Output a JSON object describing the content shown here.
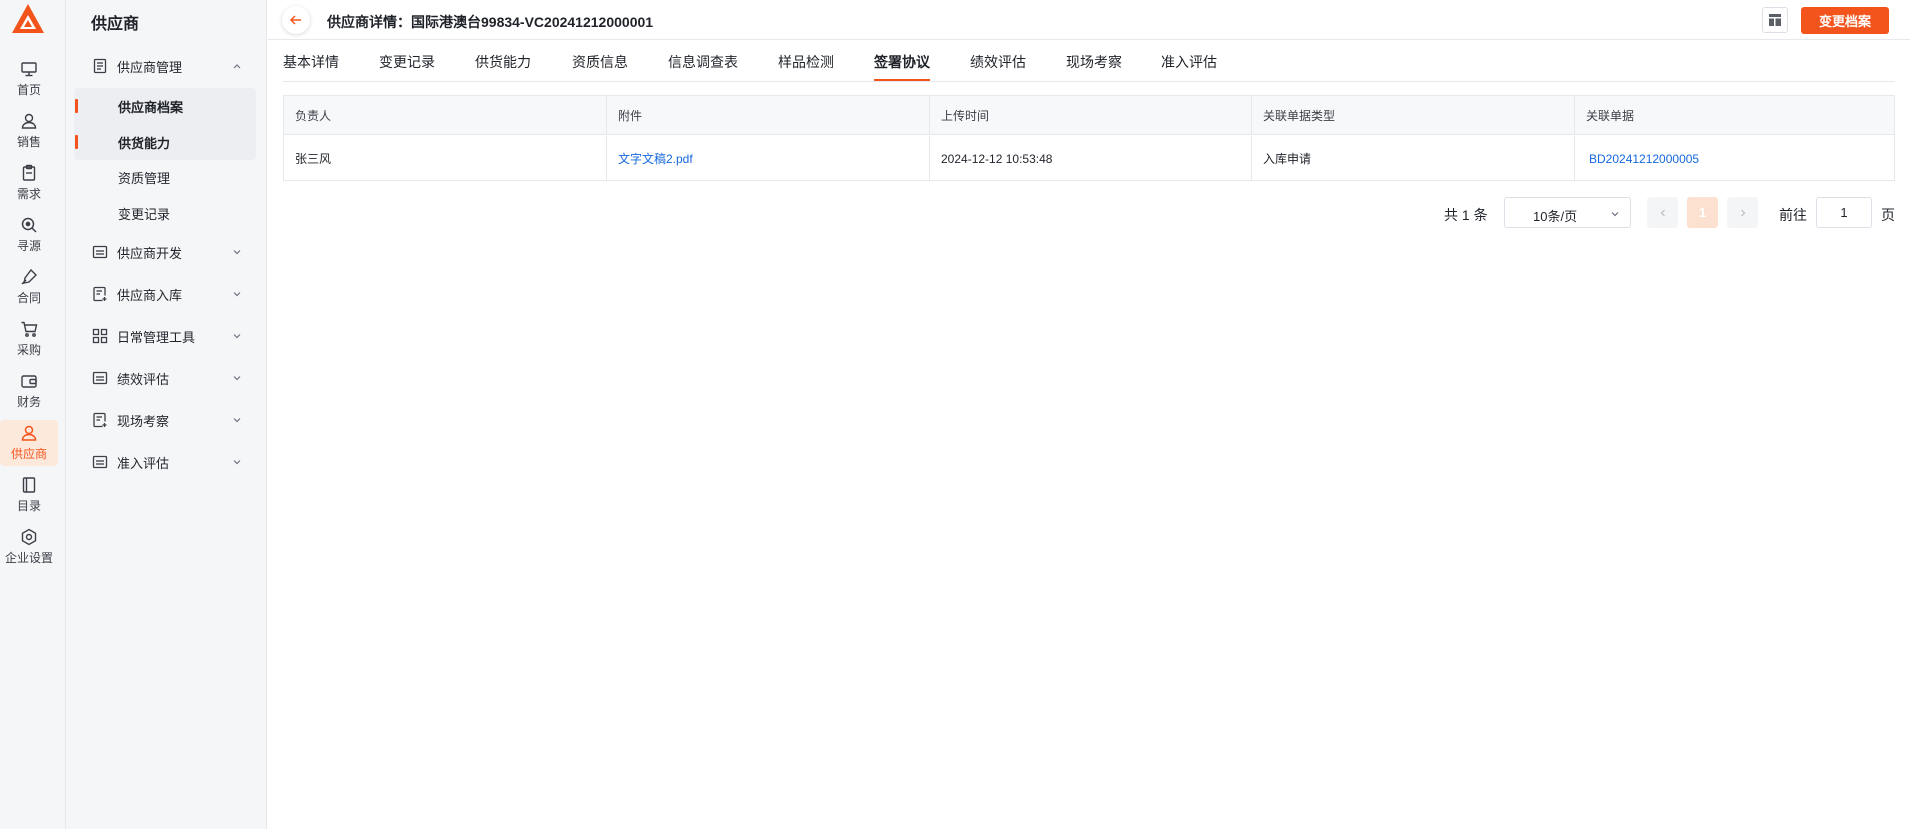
{
  "colors": {
    "accent": "#f2541b",
    "link": "#1668dc",
    "sidebar_bg": "#f5f6f8",
    "active_bg": "#fde9dc"
  },
  "rail": {
    "items": [
      {
        "label": "首页",
        "icon": "monitor-icon"
      },
      {
        "label": "销售",
        "icon": "person-icon"
      },
      {
        "label": "需求",
        "icon": "clipboard-icon"
      },
      {
        "label": "寻源",
        "icon": "search-icon"
      },
      {
        "label": "合同",
        "icon": "pen-icon"
      },
      {
        "label": "采购",
        "icon": "cart-icon"
      },
      {
        "label": "财务",
        "icon": "wallet-icon"
      },
      {
        "label": "供应商",
        "icon": "supplier-icon",
        "active": true
      },
      {
        "label": "目录",
        "icon": "book-icon"
      },
      {
        "label": "企业设置",
        "icon": "hexagon-settings-icon"
      }
    ]
  },
  "sidebar": {
    "title": "供应商",
    "groups": [
      {
        "label": "供应商管理",
        "icon": "list-icon",
        "expanded": true
      },
      {
        "label": "供应商开发",
        "icon": "card-icon"
      },
      {
        "label": "供应商入库",
        "icon": "doc-add-icon"
      },
      {
        "label": "日常管理工具",
        "icon": "grid-icon"
      },
      {
        "label": "绩效评估",
        "icon": "card-icon"
      },
      {
        "label": "现场考察",
        "icon": "doc-add-icon"
      },
      {
        "label": "准入评估",
        "icon": "card-icon"
      }
    ],
    "sub_items": [
      {
        "label": "供应商档案",
        "current": true
      },
      {
        "label": "供货能力",
        "current": true
      },
      {
        "label": "资质管理"
      },
      {
        "label": "变更记录"
      }
    ]
  },
  "header": {
    "title": "供应商详情：国际港澳台99834-VC20241212000001",
    "primary_button": "变更档案"
  },
  "tabs": [
    {
      "label": "基本详情"
    },
    {
      "label": "变更记录"
    },
    {
      "label": "供货能力"
    },
    {
      "label": "资质信息"
    },
    {
      "label": "信息调查表"
    },
    {
      "label": "样品检测"
    },
    {
      "label": "签署协议",
      "active": true
    },
    {
      "label": "绩效评估"
    },
    {
      "label": "现场考察"
    },
    {
      "label": "准入评估"
    }
  ],
  "table": {
    "columns": [
      "负责人",
      "附件",
      "上传时间",
      "关联单据类型",
      "关联单据"
    ],
    "rows": [
      [
        "张三风",
        "文字文稿2.pdf",
        "2024-12-12 10:53:48",
        "入库申请",
        "BD20241212000005"
      ]
    ]
  },
  "pagination": {
    "total_text": "共 1 条",
    "page_size": "10条/页",
    "current_page": "1",
    "goto_label": "前往",
    "goto_value": "1",
    "page_suffix": "页"
  }
}
